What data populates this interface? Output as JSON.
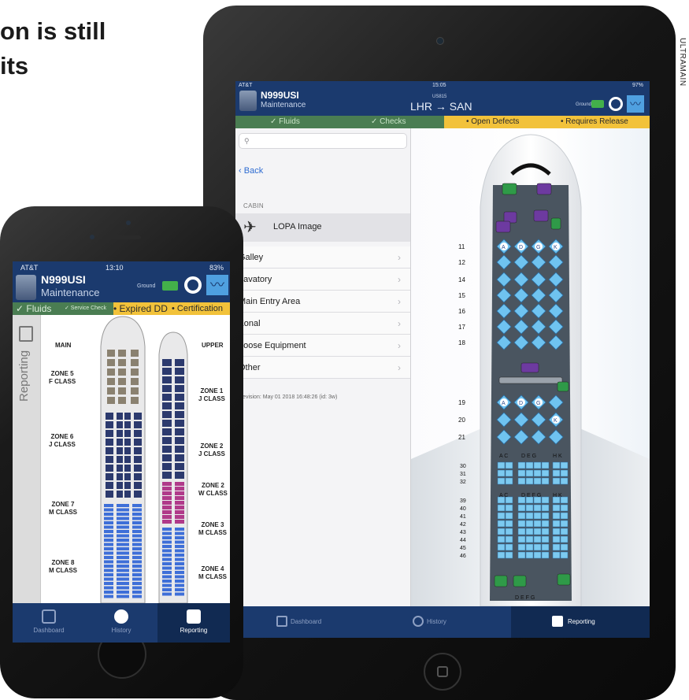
{
  "headline": {
    "line1": "on is still",
    "line2": "its"
  },
  "credit": "ULTRAMAIN",
  "ipad": {
    "status": {
      "carrier": "AT&T",
      "time": "15:05",
      "battery": "97%"
    },
    "aircraft": {
      "tail": "N999USI",
      "role": "Maintenance"
    },
    "flight": {
      "number": "US815",
      "route": "LHR → SAN"
    },
    "ground_label": "Ground",
    "statusbar": {
      "fluids": "✓ Fluids",
      "checks": "✓ Checks",
      "open_defects": "• Open Defects",
      "requires_release": "• Requires Release"
    },
    "sidebar": {
      "search_placeholder": "",
      "back_label": "Back",
      "section": "CABIN",
      "selected_item": "LOPA Image",
      "items": [
        {
          "label": "Galley"
        },
        {
          "label": "Lavatory"
        },
        {
          "label": "Main Entry Area"
        },
        {
          "label": "Zonal"
        },
        {
          "label": "Loose Equipment"
        },
        {
          "label": "Other"
        }
      ],
      "revision": "Revision: May 01 2018 16:48:26 (id: 3w)"
    },
    "seatmap": {
      "rows_upper": [
        "11",
        "12",
        "14",
        "15",
        "16",
        "17",
        "18"
      ],
      "rows_mid": [
        "19",
        "20",
        "21"
      ],
      "rows_lower": [
        "30",
        "31",
        "32",
        "39",
        "40",
        "41",
        "42",
        "43",
        "44",
        "45",
        "46"
      ],
      "cols_a": [
        "A",
        "D",
        "G",
        "K"
      ],
      "cols_b": [
        "A",
        "D",
        "G",
        "K"
      ],
      "cols_c": [
        "A C",
        "D E G",
        "H K"
      ],
      "cols_d": [
        "A C",
        "D E F G",
        "H K"
      ],
      "cols_e": "D E F G"
    },
    "tabs": [
      {
        "label": "Dashboard"
      },
      {
        "label": "History"
      },
      {
        "label": "Reporting"
      }
    ]
  },
  "iphone": {
    "status": {
      "carrier": "AT&T",
      "time": "13:10",
      "battery": "83%"
    },
    "aircraft": {
      "tail": "N999USI",
      "role": "Maintenance"
    },
    "ground_label": "Ground",
    "statusbar": {
      "fluids": "✓ Fluids",
      "service_check": "✓ Service Check",
      "expired_dd": "• Expired DD",
      "certification": "• Certification"
    },
    "side_tab": "Reporting",
    "deck_main": "MAIN",
    "deck_upper": "UPPER",
    "zones_left": [
      {
        "name": "ZONE 5",
        "cls": "F CLASS"
      },
      {
        "name": "ZONE 6",
        "cls": "J CLASS"
      },
      {
        "name": "ZONE 7",
        "cls": "M CLASS"
      },
      {
        "name": "ZONE 8",
        "cls": "M CLASS"
      }
    ],
    "zones_right": [
      {
        "name": "ZONE 1",
        "cls": "J CLASS"
      },
      {
        "name": "ZONE 2",
        "cls": "J CLASS"
      },
      {
        "name": "ZONE 2",
        "cls": "W CLASS"
      },
      {
        "name": "ZONE 3",
        "cls": "M CLASS"
      },
      {
        "name": "ZONE 4",
        "cls": "M CLASS"
      }
    ],
    "tabs": [
      {
        "label": "Dashboard"
      },
      {
        "label": "History"
      },
      {
        "label": "Reporting"
      }
    ]
  }
}
